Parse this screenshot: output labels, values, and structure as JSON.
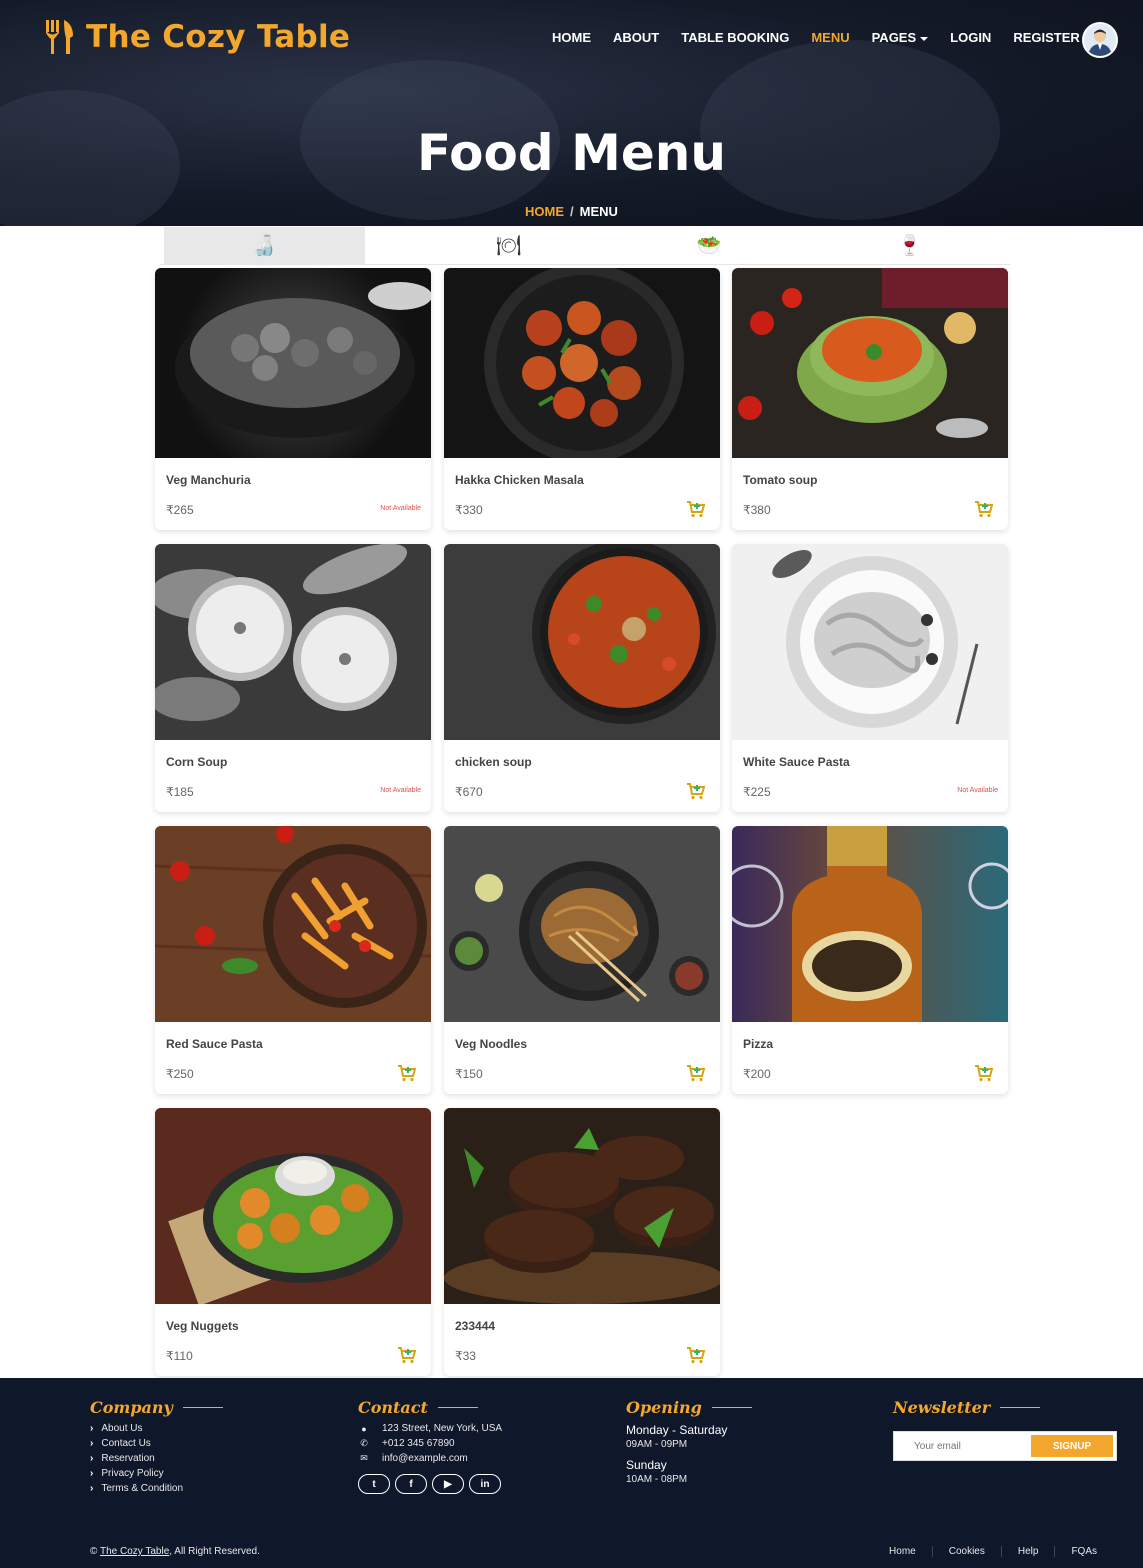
{
  "brand": {
    "name": "The Cozy Table",
    "accent_color": "#f3a72c",
    "logo_icon": "fork-knife-icon"
  },
  "nav": {
    "items": [
      "HOME",
      "ABOUT",
      "TABLE BOOKING",
      "MENU",
      "PAGES",
      "LOGIN",
      "REGISTER"
    ],
    "active": "MENU"
  },
  "hero": {
    "title": "Food Menu",
    "breadcrumb_home": "HOME",
    "breadcrumb_sep": "/",
    "breadcrumb_current": "MENU"
  },
  "tabs": [
    {
      "icon": "bottle-icon",
      "glyph": "🍶",
      "active": true
    },
    {
      "icon": "plate-icon",
      "glyph": "🍽",
      "active": false
    },
    {
      "icon": "globe-dish-icon",
      "glyph": "🥗",
      "active": false
    },
    {
      "icon": "wine-bottle-glass-icon",
      "glyph": "🍷",
      "active": false
    }
  ],
  "items": [
    {
      "name": "Veg Manchuria",
      "price": "₹265",
      "status": "Not Available",
      "available": false
    },
    {
      "name": "Hakka Chicken Masala",
      "price": "₹330",
      "status": "",
      "available": true
    },
    {
      "name": "Tomato soup",
      "price": "₹380",
      "status": "",
      "available": true
    },
    {
      "name": "Corn Soup",
      "price": "₹185",
      "status": "Not Available",
      "available": false
    },
    {
      "name": "chicken soup",
      "price": "₹670",
      "status": "",
      "available": true
    },
    {
      "name": "White Sauce Pasta",
      "price": "₹225",
      "status": "Not Available",
      "available": false
    },
    {
      "name": "Red Sauce Pasta",
      "price": "₹250",
      "status": "",
      "available": true
    },
    {
      "name": "Veg Noodles",
      "price": "₹150",
      "status": "",
      "available": true
    },
    {
      "name": "Pizza",
      "price": "₹200",
      "status": "",
      "available": true
    },
    {
      "name": "Veg Nuggets",
      "price": "₹110",
      "status": "",
      "available": true
    },
    {
      "name": "233444",
      "price": "₹33",
      "status": "",
      "available": true
    }
  ],
  "footer": {
    "company": {
      "heading": "Company",
      "links": [
        "About Us",
        "Contact Us",
        "Reservation",
        "Privacy Policy",
        "Terms & Condition"
      ]
    },
    "contact": {
      "heading": "Contact",
      "address": "123 Street, New York, USA",
      "phone": "+012 345 67890",
      "email": "info@example.com",
      "socials": [
        "twitter-icon",
        "facebook-icon",
        "youtube-icon",
        "linkedin-icon"
      ]
    },
    "opening": {
      "heading": "Opening",
      "day1": "Monday - Saturday",
      "time1": "09AM - 09PM",
      "day2": "Sunday",
      "time2": "10AM - 08PM"
    },
    "newsletter": {
      "heading": "Newsletter",
      "placeholder": "Your email",
      "button": "SIGNUP"
    },
    "copyright_symbol": "©",
    "copyright_brand": "The Cozy Table",
    "copyright_rest": ", All Right Reserved.",
    "bottom_links": [
      "Home",
      "Cookies",
      "Help",
      "FQAs"
    ]
  }
}
